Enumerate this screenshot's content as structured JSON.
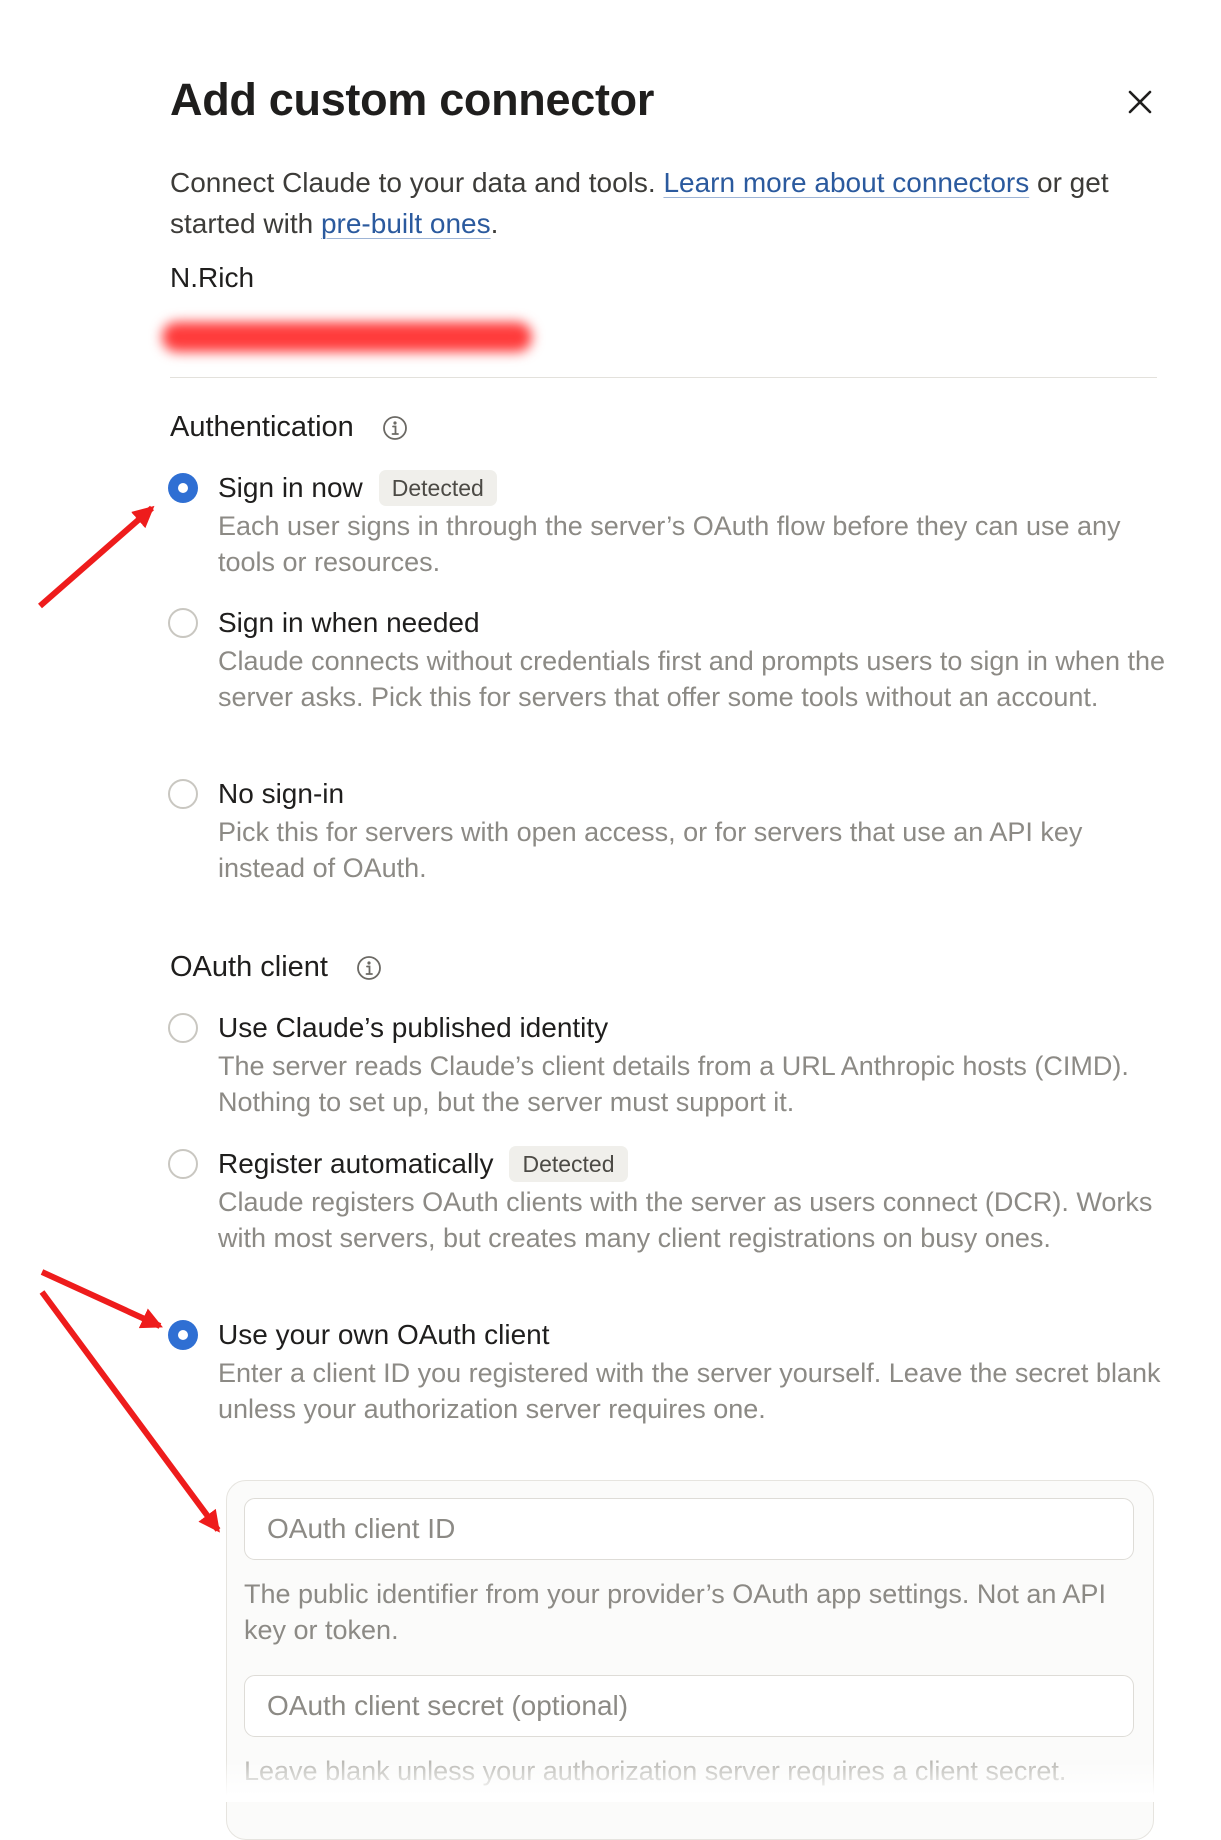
{
  "dialog": {
    "title": "Add custom connector",
    "close_icon": "close-icon",
    "intro": {
      "text_before": "Connect Claude to your data and tools. ",
      "learn_link": "Learn more about connectors",
      "text_middle": " or get started with ",
      "prebuilt_link": "pre-built ones",
      "text_after": "."
    },
    "connector_name": "N.Rich",
    "redaction_color": "#ff3b3b"
  },
  "authentication": {
    "title": "Authentication",
    "info_icon": "info-icon",
    "options": [
      {
        "label": "Sign in now",
        "badge": "Detected",
        "description": "Each user signs in through the server’s OAuth flow before they can use any tools or resources.",
        "selected": true
      },
      {
        "label": "Sign in when needed",
        "badge": "",
        "description": "Claude connects without credentials first and prompts users to sign in when the server asks. Pick this for servers that offer some tools without an account.",
        "selected": false
      },
      {
        "label": "No sign-in",
        "badge": "",
        "description": "Pick this for servers with open access, or for servers that use an API key instead of OAuth.",
        "selected": false
      }
    ]
  },
  "oauth_client": {
    "title": "OAuth client",
    "info_icon": "info-icon",
    "options": [
      {
        "label": "Use Claude’s published identity",
        "badge": "",
        "description": "The server reads Claude’s client details from a URL Anthropic hosts (CIMD). Nothing to set up, but the server must support it.",
        "selected": false
      },
      {
        "label": "Register automatically",
        "badge": "Detected",
        "description": "Claude registers OAuth clients with the server as users connect (DCR). Works with most servers, but creates many client registrations on busy ones.",
        "selected": false
      },
      {
        "label": "Use your own OAuth client",
        "badge": "",
        "description": "Enter a client ID you registered with the server yourself. Leave the secret blank unless your authorization server requires one.",
        "selected": true
      }
    ],
    "client_id": {
      "placeholder": "OAuth client ID",
      "value": "",
      "help": "The public identifier from your provider’s OAuth app settings. Not an API key or token."
    },
    "client_secret": {
      "placeholder": "OAuth client secret (optional)",
      "value": "",
      "help": "Leave blank unless your authorization server requires a client secret."
    }
  },
  "colors": {
    "accent": "#2f6fd3",
    "link": "#2b5a9e",
    "annotation_arrow": "#ee1c1c"
  }
}
